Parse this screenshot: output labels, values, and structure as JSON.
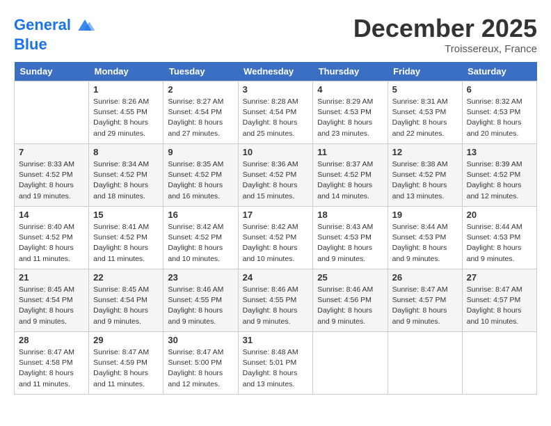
{
  "header": {
    "logo_line1": "General",
    "logo_line2": "Blue",
    "month": "December 2025",
    "location": "Troissereux, France"
  },
  "days_of_week": [
    "Sunday",
    "Monday",
    "Tuesday",
    "Wednesday",
    "Thursday",
    "Friday",
    "Saturday"
  ],
  "weeks": [
    [
      {
        "num": "",
        "info": ""
      },
      {
        "num": "1",
        "info": "Sunrise: 8:26 AM\nSunset: 4:55 PM\nDaylight: 8 hours\nand 29 minutes."
      },
      {
        "num": "2",
        "info": "Sunrise: 8:27 AM\nSunset: 4:54 PM\nDaylight: 8 hours\nand 27 minutes."
      },
      {
        "num": "3",
        "info": "Sunrise: 8:28 AM\nSunset: 4:54 PM\nDaylight: 8 hours\nand 25 minutes."
      },
      {
        "num": "4",
        "info": "Sunrise: 8:29 AM\nSunset: 4:53 PM\nDaylight: 8 hours\nand 23 minutes."
      },
      {
        "num": "5",
        "info": "Sunrise: 8:31 AM\nSunset: 4:53 PM\nDaylight: 8 hours\nand 22 minutes."
      },
      {
        "num": "6",
        "info": "Sunrise: 8:32 AM\nSunset: 4:53 PM\nDaylight: 8 hours\nand 20 minutes."
      }
    ],
    [
      {
        "num": "7",
        "info": "Sunrise: 8:33 AM\nSunset: 4:52 PM\nDaylight: 8 hours\nand 19 minutes."
      },
      {
        "num": "8",
        "info": "Sunrise: 8:34 AM\nSunset: 4:52 PM\nDaylight: 8 hours\nand 18 minutes."
      },
      {
        "num": "9",
        "info": "Sunrise: 8:35 AM\nSunset: 4:52 PM\nDaylight: 8 hours\nand 16 minutes."
      },
      {
        "num": "10",
        "info": "Sunrise: 8:36 AM\nSunset: 4:52 PM\nDaylight: 8 hours\nand 15 minutes."
      },
      {
        "num": "11",
        "info": "Sunrise: 8:37 AM\nSunset: 4:52 PM\nDaylight: 8 hours\nand 14 minutes."
      },
      {
        "num": "12",
        "info": "Sunrise: 8:38 AM\nSunset: 4:52 PM\nDaylight: 8 hours\nand 13 minutes."
      },
      {
        "num": "13",
        "info": "Sunrise: 8:39 AM\nSunset: 4:52 PM\nDaylight: 8 hours\nand 12 minutes."
      }
    ],
    [
      {
        "num": "14",
        "info": "Sunrise: 8:40 AM\nSunset: 4:52 PM\nDaylight: 8 hours\nand 11 minutes."
      },
      {
        "num": "15",
        "info": "Sunrise: 8:41 AM\nSunset: 4:52 PM\nDaylight: 8 hours\nand 11 minutes."
      },
      {
        "num": "16",
        "info": "Sunrise: 8:42 AM\nSunset: 4:52 PM\nDaylight: 8 hours\nand 10 minutes."
      },
      {
        "num": "17",
        "info": "Sunrise: 8:42 AM\nSunset: 4:52 PM\nDaylight: 8 hours\nand 10 minutes."
      },
      {
        "num": "18",
        "info": "Sunrise: 8:43 AM\nSunset: 4:53 PM\nDaylight: 8 hours\nand 9 minutes."
      },
      {
        "num": "19",
        "info": "Sunrise: 8:44 AM\nSunset: 4:53 PM\nDaylight: 8 hours\nand 9 minutes."
      },
      {
        "num": "20",
        "info": "Sunrise: 8:44 AM\nSunset: 4:53 PM\nDaylight: 8 hours\nand 9 minutes."
      }
    ],
    [
      {
        "num": "21",
        "info": "Sunrise: 8:45 AM\nSunset: 4:54 PM\nDaylight: 8 hours\nand 9 minutes."
      },
      {
        "num": "22",
        "info": "Sunrise: 8:45 AM\nSunset: 4:54 PM\nDaylight: 8 hours\nand 9 minutes."
      },
      {
        "num": "23",
        "info": "Sunrise: 8:46 AM\nSunset: 4:55 PM\nDaylight: 8 hours\nand 9 minutes."
      },
      {
        "num": "24",
        "info": "Sunrise: 8:46 AM\nSunset: 4:55 PM\nDaylight: 8 hours\nand 9 minutes."
      },
      {
        "num": "25",
        "info": "Sunrise: 8:46 AM\nSunset: 4:56 PM\nDaylight: 8 hours\nand 9 minutes."
      },
      {
        "num": "26",
        "info": "Sunrise: 8:47 AM\nSunset: 4:57 PM\nDaylight: 8 hours\nand 9 minutes."
      },
      {
        "num": "27",
        "info": "Sunrise: 8:47 AM\nSunset: 4:57 PM\nDaylight: 8 hours\nand 10 minutes."
      }
    ],
    [
      {
        "num": "28",
        "info": "Sunrise: 8:47 AM\nSunset: 4:58 PM\nDaylight: 8 hours\nand 11 minutes."
      },
      {
        "num": "29",
        "info": "Sunrise: 8:47 AM\nSunset: 4:59 PM\nDaylight: 8 hours\nand 11 minutes."
      },
      {
        "num": "30",
        "info": "Sunrise: 8:47 AM\nSunset: 5:00 PM\nDaylight: 8 hours\nand 12 minutes."
      },
      {
        "num": "31",
        "info": "Sunrise: 8:48 AM\nSunset: 5:01 PM\nDaylight: 8 hours\nand 13 minutes."
      },
      {
        "num": "",
        "info": ""
      },
      {
        "num": "",
        "info": ""
      },
      {
        "num": "",
        "info": ""
      }
    ]
  ]
}
